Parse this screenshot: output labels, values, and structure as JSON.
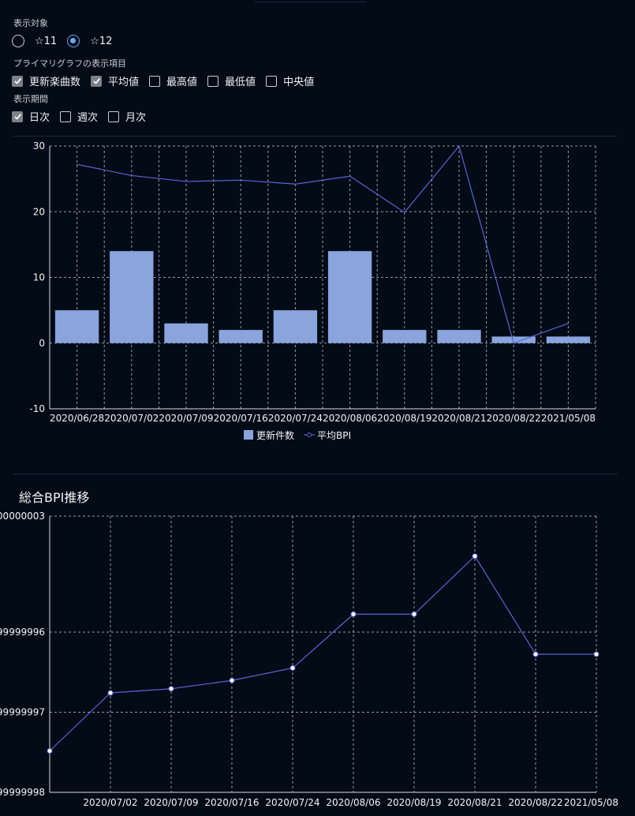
{
  "controls": {
    "target_label": "表示対象",
    "targets": [
      {
        "label": "☆11",
        "selected": false
      },
      {
        "label": "☆12",
        "selected": true
      }
    ],
    "primary_label": "プライマリグラフの表示項目",
    "primary_items": [
      {
        "label": "更新楽曲数",
        "checked": true
      },
      {
        "label": "平均値",
        "checked": true
      },
      {
        "label": "最高値",
        "checked": false
      },
      {
        "label": "最低値",
        "checked": false
      },
      {
        "label": "中央値",
        "checked": false
      }
    ],
    "period_label": "表示期間",
    "periods": [
      {
        "label": "日次",
        "checked": true
      },
      {
        "label": "週次",
        "checked": false
      },
      {
        "label": "月次",
        "checked": false
      }
    ]
  },
  "colors": {
    "background": "#020b16",
    "bar": "#8aa4dd",
    "line": "#5c63d6",
    "grid": "#c8ccd2"
  },
  "chart_data": [
    {
      "type": "bar",
      "categories": [
        "2020/06/28",
        "2020/07/02",
        "2020/07/09",
        "2020/07/16",
        "2020/07/24",
        "2020/08/06",
        "2020/08/19",
        "2020/08/21",
        "2020/08/22",
        "2021/05/08"
      ],
      "series": [
        {
          "name": "更新件数",
          "type": "bar",
          "values": [
            5,
            14,
            3,
            2,
            5,
            14,
            2,
            2,
            1,
            1
          ]
        },
        {
          "name": "平均BPI",
          "type": "line",
          "values": [
            27.2,
            25.5,
            24.6,
            24.8,
            24.2,
            25.4,
            19.9,
            30,
            0,
            3
          ]
        }
      ],
      "ylim": [
        -10,
        30
      ],
      "yticks": [
        "30",
        "20",
        "10",
        "0",
        "-10"
      ],
      "grid": true,
      "legend": "bottom"
    },
    {
      "type": "line",
      "title": "総合BPI推移",
      "categories": [
        "2020/06/28",
        "2020/07/02",
        "2020/07/09",
        "2020/07/16",
        "2020/07/24",
        "2020/08/06",
        "2020/08/19",
        "2020/08/21",
        "2020/08/22",
        "2021/05/08"
      ],
      "xticks": [
        "",
        "2020/07/02",
        "2020/07/09",
        "2020/07/16",
        "2020/07/24",
        "2020/08/06",
        "2020/08/19",
        "2020/08/21",
        "2020/08/22",
        "2021/05/08"
      ],
      "yticks": [
        "00000003",
        "99999996",
        "99999997",
        "99999998"
      ],
      "series": [
        {
          "values": [
            0.15,
            0.36,
            0.375,
            0.405,
            0.45,
            0.645,
            0.645,
            0.855,
            0.5,
            0.5
          ]
        }
      ],
      "ylim": [
        0,
        1
      ],
      "grid": true
    }
  ]
}
